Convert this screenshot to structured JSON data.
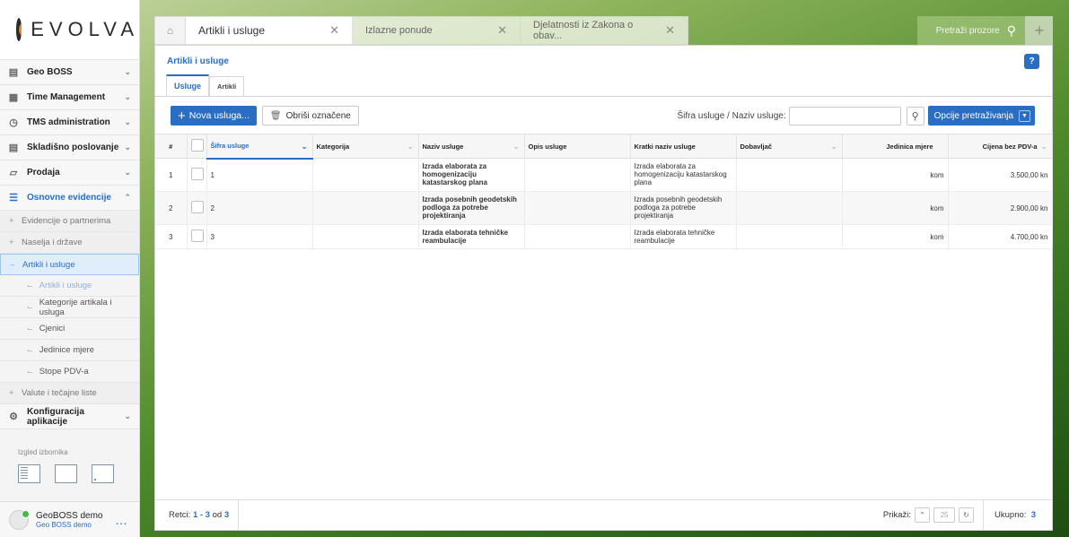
{
  "app": {
    "logo_text": "EVOLVA",
    "brand_color": "#f08b1e",
    "accent": "#2a6ec4"
  },
  "sidebar": {
    "items": [
      {
        "label": "Geo BOSS",
        "icon": "book-icon"
      },
      {
        "label": "Time Management",
        "icon": "calendar-icon"
      },
      {
        "label": "TMS administration",
        "icon": "clock-icon"
      },
      {
        "label": "Skladišno poslovanje",
        "icon": "document-icon"
      },
      {
        "label": "Prodaja",
        "icon": "basket-icon"
      },
      {
        "label": "Osnovne evidencije",
        "icon": "list-icon"
      }
    ],
    "sub_items": [
      {
        "label": "Evidencije o partnerima"
      },
      {
        "label": "Naselja i države"
      },
      {
        "label": "Artikli i usluge"
      },
      {
        "label": "Valute i tečajne liste"
      }
    ],
    "sub2_items": [
      {
        "label": "Artikli i usluge"
      },
      {
        "label": "Kategorije artikala i usluga"
      },
      {
        "label": "Cjenici"
      },
      {
        "label": "Jedinice mjere"
      },
      {
        "label": "Stope PDV-a"
      }
    ],
    "config_label": "Konfiguracija aplikacije",
    "layout_label": "Izgled izbornika",
    "user": {
      "name": "GeoBOSS demo",
      "company": "Geo BOSS demo"
    }
  },
  "tabs": [
    {
      "label": "Artikli i usluge",
      "active": true
    },
    {
      "label": "Izlazne ponude"
    },
    {
      "label": "Djelatnosti iz Zakona o obav..."
    }
  ],
  "tab_search_placeholder": "Pretraži prozore",
  "panel": {
    "title": "Artikli i usluge",
    "help": "?",
    "subtabs": [
      "Usluge",
      "Artikli"
    ],
    "new_button": "Nova usluga...",
    "delete_button": "Obriši označene",
    "search_label": "Šifra usluge / Naziv usluge:",
    "search_value": "",
    "options_button": "Opcije pretraživanja"
  },
  "table": {
    "columns": [
      "#",
      "Šifra usluge",
      "Kategorija",
      "Naziv usluge",
      "Opis usluge",
      "Kratki naziv usluge",
      "Dobavljač",
      "Jedinica mjere",
      "Cijena bez PDV-a"
    ],
    "rows": [
      {
        "idx": "1",
        "code": "1",
        "category": "",
        "name": "Izrada elaborata za homogenizaciju katastarskog plana",
        "desc": "",
        "short": "Izrada elaborata za homogenizaciju katastarskog plana",
        "supplier": "",
        "unit": "kom",
        "price": "3.500,00  kn"
      },
      {
        "idx": "2",
        "code": "2",
        "category": "",
        "name": "Izrada posebnih geodetskih podloga za potrebe projektiranja",
        "desc": "",
        "short": "Izrada posebnih geodetskih podloga za potrebe projektiranja",
        "supplier": "",
        "unit": "kom",
        "price": "2.900,00  kn"
      },
      {
        "idx": "3",
        "code": "3",
        "category": "",
        "name": "Izrada elaborata tehničke reambulacije",
        "desc": "",
        "short": "Izrada elaborata tehničke reambulacije",
        "supplier": "",
        "unit": "kom",
        "price": "4.700,00  kn"
      }
    ]
  },
  "footer": {
    "rows_label": "Retci:",
    "rows_range": "1 - 3",
    "of_label": "od",
    "rows_total": "3",
    "show_label": "Prikaži:",
    "page_size": "25",
    "total_label": "Ukupno:",
    "total": "3"
  }
}
